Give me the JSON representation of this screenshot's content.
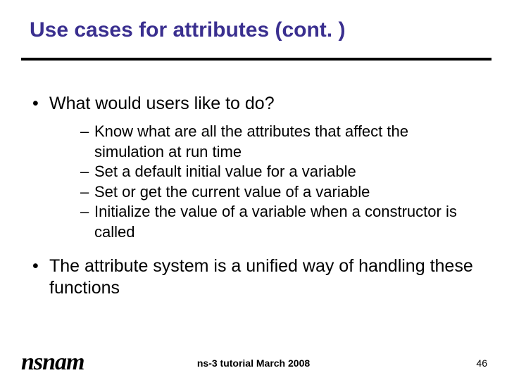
{
  "title": "Use cases for attributes (cont. )",
  "bullets": {
    "b0": "What would users like to do?",
    "sub": {
      "s0": "Know what are all the attributes that affect the simulation at run time",
      "s1": "Set a default initial value for a variable",
      "s2": "Set or get the current value of a variable",
      "s3": "Initialize the value of a variable when a constructor is called"
    },
    "b1": "The attribute system is a unified way of handling these functions"
  },
  "footer": {
    "center": "ns-3 tutorial March 2008",
    "page": "46",
    "logo": "nsnam"
  }
}
